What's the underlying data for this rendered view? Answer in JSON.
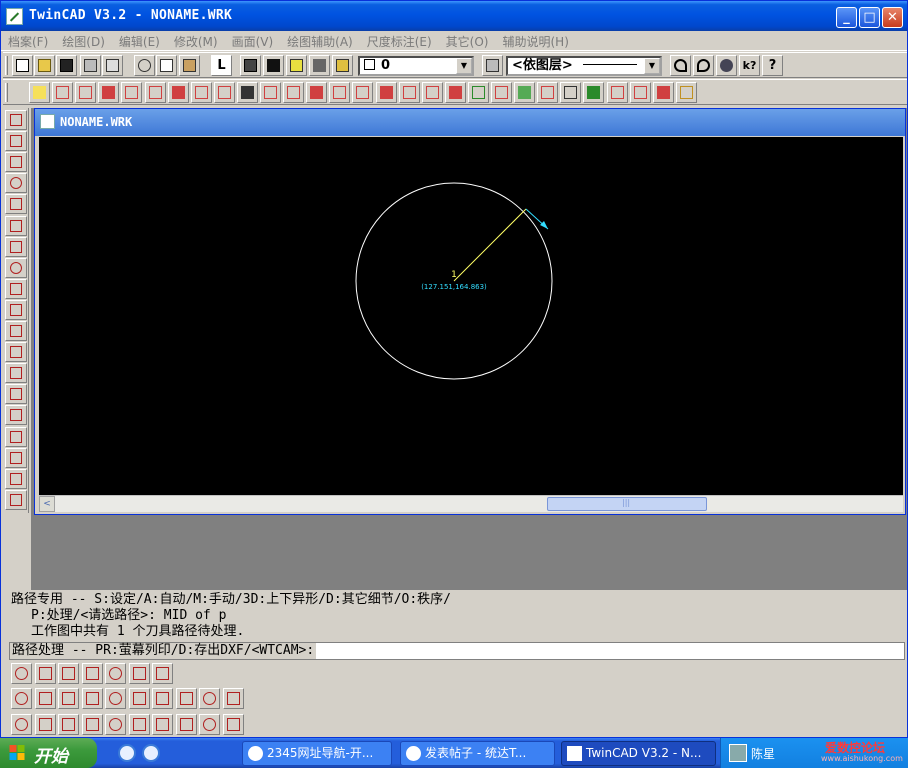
{
  "window": {
    "title": "TwinCAD V3.2 - NONAME.WRK",
    "controls": {
      "minimize": "_",
      "maximize": "□",
      "close": "✕"
    }
  },
  "menu": [
    "档案(F)",
    "绘图(D)",
    "编辑(E)",
    "修改(M)",
    "画面(V)",
    "绘图辅助(A)",
    "尺度标注(E)",
    "其它(O)",
    "辅助说明(H)"
  ],
  "toolbar": {
    "text_button": "L",
    "color_combo": "0",
    "layer_combo": "<依图层>",
    "help_button": "?"
  },
  "child_window": {
    "title": "NONAME.WRK"
  },
  "drawing": {
    "center_label": "1",
    "coordinate_label": "(127.151,164.863)",
    "colors": {
      "background": "#000000",
      "circle": "#ffffff",
      "radius_line": "#ffff66",
      "arrow": "#33ddff",
      "coordinate_text": "#33ddff"
    }
  },
  "command_area": {
    "line1": "路径专用 -- S:设定/A:自动/M:手动/3D:上下异形/D:其它细节/O:秩序/",
    "line2": "P:处理/<请选路径>: MID of p",
    "line3": "工作图中共有 1 个刀具路径待处理.",
    "prompt": "路径处理 -- PR:萤幕列印/D:存出DXF/<WTCAM>:"
  },
  "scrollbar": {
    "left_arrow": "<",
    "grip": "|||"
  },
  "taskbar": {
    "start_label": "开始",
    "tasks": [
      {
        "label": "2345网址导航-开..."
      },
      {
        "label": "发表帖子 - 统达T..."
      },
      {
        "label": "TwinCAD V3.2 - N..."
      }
    ],
    "tray_user": "陈星",
    "watermark": "爱数控论坛",
    "watermark_url": "www.aishukong.com"
  }
}
